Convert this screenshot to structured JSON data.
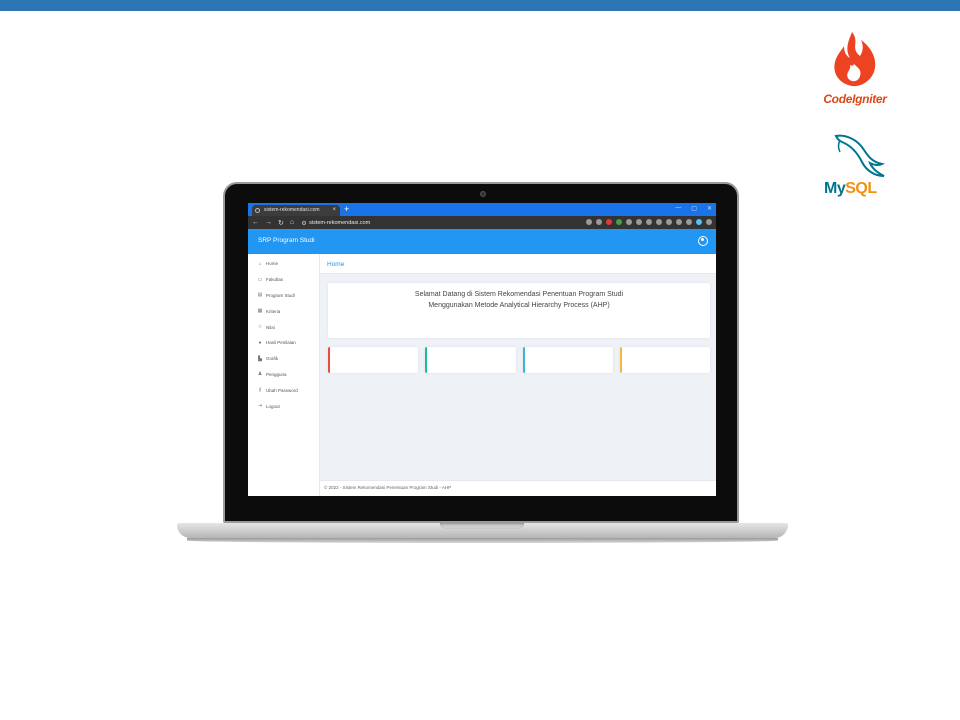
{
  "slide": {
    "accent_color": "#2e75b6"
  },
  "logos": {
    "codeigniter_text": "CodeIgniter",
    "mysql_my": "My",
    "mysql_sql": "SQL"
  },
  "browser": {
    "tab_title": "sistem-rekomendasi.com",
    "tab_close": "×",
    "new_tab": "+",
    "url": "sistem-rekomendasi.com",
    "nav": {
      "back": "←",
      "forward": "→",
      "reload": "↻",
      "home": "⌂"
    },
    "window_controls": [
      "—",
      "▢",
      "✕"
    ]
  },
  "app": {
    "title": "SRP Program Studi",
    "header_color": "#2196f3",
    "sidebar": [
      {
        "icon": "⌂",
        "icon_name": "home-icon",
        "label": "Home"
      },
      {
        "icon": "▭",
        "icon_name": "building-icon",
        "label": "Fakultas"
      },
      {
        "icon": "▤",
        "icon_name": "list-icon",
        "label": "Program Studi"
      },
      {
        "icon": "▦",
        "icon_name": "table-icon",
        "label": "Kriteria"
      },
      {
        "icon": "☆",
        "icon_name": "star-icon",
        "label": "Nilai"
      },
      {
        "icon": "●",
        "icon_name": "globe-icon",
        "label": "Hasil Penilaian"
      },
      {
        "icon": "▙",
        "icon_name": "chart-icon",
        "label": "Grafik"
      },
      {
        "icon": "♟",
        "icon_name": "user-icon",
        "label": "Pengguna"
      },
      {
        "icon": "⚷",
        "icon_name": "key-icon",
        "label": "Ubah Password"
      },
      {
        "icon": "⇥",
        "icon_name": "logout-icon",
        "label": "Logout"
      }
    ],
    "breadcrumb": "Home",
    "welcome_line1": "Selamat Datang di Sistem Rekomendasi Penentuan Program Studi",
    "welcome_line2": "Menggunakan Metode Analytical Hierarchy Process (AHP)",
    "stat_card_colors": [
      "#e74c3c",
      "#1abc9c",
      "#3bb4d8",
      "#f5b942"
    ],
    "footer": "© 2022 - Sistem Rekomendasi Penentuan Program Studi - AHP"
  }
}
